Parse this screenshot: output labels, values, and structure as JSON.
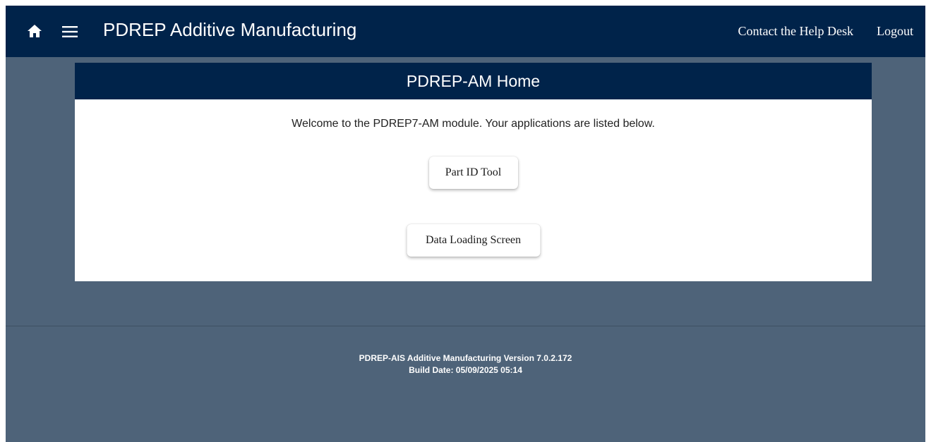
{
  "header": {
    "app_title": "PDREP Additive Manufacturing",
    "links": {
      "help_desk": "Contact the Help Desk",
      "logout": "Logout"
    },
    "icons": {
      "home": "home-icon",
      "menu": "hamburger-menu-icon"
    },
    "background_color": "#00234a"
  },
  "main": {
    "card_title": "PDREP-AM Home",
    "welcome_text": "Welcome to the PDREP7-AM module. Your applications are listed below.",
    "applications": [
      {
        "label": "Part ID Tool"
      },
      {
        "label": "Data Loading Screen"
      }
    ]
  },
  "footer": {
    "version": "PDREP-AIS Additive Manufacturing Version 7.0.2.172",
    "build_date": "Build Date: 05/09/2025 05:14"
  },
  "colors": {
    "page_background": "#4e6379",
    "accent_navy": "#00234a",
    "card_background": "#ffffff"
  }
}
